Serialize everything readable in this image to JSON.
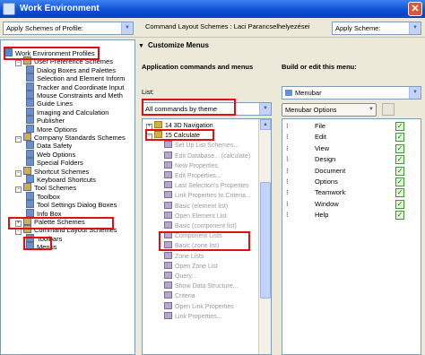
{
  "window": {
    "title": "Work Environment",
    "close_glyph": "✕"
  },
  "toolbar": {
    "apply_profile": "Apply Schemes of Profile:",
    "scheme_label": "Command Layout Schemes : Laci Parancselhelyezései",
    "apply_scheme": "Apply Scheme:"
  },
  "tree": [
    {
      "label": "Work Environment Profiles",
      "indent": 0,
      "expander": "",
      "icon_color": "#4a8cd8"
    },
    {
      "label": "User Preference Schemes",
      "indent": 1,
      "expander": "−",
      "icon_color": "#d4b040"
    },
    {
      "label": "Dialog Boxes and Palettes",
      "indent": 2,
      "expander": "",
      "icon_color": "#6a8fd0"
    },
    {
      "label": "Selection and Element Inform",
      "indent": 2,
      "expander": "",
      "icon_color": "#6a8fd0"
    },
    {
      "label": "Tracker and Coordinate Input",
      "indent": 2,
      "expander": "",
      "icon_color": "#6a8fd0"
    },
    {
      "label": "Mouse Constraints and Meth",
      "indent": 2,
      "expander": "",
      "icon_color": "#6a8fd0"
    },
    {
      "label": "Guide Lines",
      "indent": 2,
      "expander": "",
      "icon_color": "#6a8fd0"
    },
    {
      "label": "Imaging and Calculation",
      "indent": 2,
      "expander": "",
      "icon_color": "#6a8fd0"
    },
    {
      "label": "Publisher",
      "indent": 2,
      "expander": "",
      "icon_color": "#6a8fd0"
    },
    {
      "label": "More Options",
      "indent": 2,
      "expander": "",
      "icon_color": "#6a8fd0"
    },
    {
      "label": "Company Standards Schemes",
      "indent": 1,
      "expander": "−",
      "icon_color": "#d4b040"
    },
    {
      "label": "Data Safety",
      "indent": 2,
      "expander": "",
      "icon_color": "#6a8fd0"
    },
    {
      "label": "Web Options",
      "indent": 2,
      "expander": "",
      "icon_color": "#6a8fd0"
    },
    {
      "label": "Special Folders",
      "indent": 2,
      "expander": "",
      "icon_color": "#6a8fd0"
    },
    {
      "label": "Shortcut Schemes",
      "indent": 1,
      "expander": "−",
      "icon_color": "#d4b040"
    },
    {
      "label": "Keyboard Shortcuts",
      "indent": 2,
      "expander": "",
      "icon_color": "#6a8fd0"
    },
    {
      "label": "Tool Schemes",
      "indent": 1,
      "expander": "−",
      "icon_color": "#d4b040"
    },
    {
      "label": "Toolbox",
      "indent": 2,
      "expander": "",
      "icon_color": "#6a8fd0"
    },
    {
      "label": "Tool Settings Dialog Boxes",
      "indent": 2,
      "expander": "",
      "icon_color": "#6a8fd0"
    },
    {
      "label": "Info Box",
      "indent": 2,
      "expander": "",
      "icon_color": "#6a8fd0"
    },
    {
      "label": "Palette Schemes",
      "indent": 1,
      "expander": "+",
      "icon_color": "#d4b040"
    },
    {
      "label": "Command Layout Schemes",
      "indent": 1,
      "expander": "−",
      "icon_color": "#d4b040"
    },
    {
      "label": "Toolbars",
      "indent": 2,
      "expander": "",
      "icon_color": "#6a8fd0"
    },
    {
      "label": "Menus",
      "indent": 2,
      "expander": "",
      "icon_color": "#6a8fd0"
    }
  ],
  "customize": {
    "header": "Customize Menus",
    "header_glyph": "▼",
    "left_title": "Application commands and menus",
    "list_label": "List:",
    "list_value": "All commands by theme",
    "right_title": "Build or edit this menu:",
    "menu_value": "Menubar",
    "menubar_options": "Menubar Options",
    "combo_arrow": "▼",
    "scroll_up": "▲",
    "scroll_down": "▼"
  },
  "commands": [
    {
      "label": "14 3D Navigation",
      "expander": "+",
      "grey": false
    },
    {
      "label": "15 Calculate",
      "expander": "−",
      "grey": false
    },
    {
      "label": "Set Up List Schemes...",
      "expander": "",
      "grey": true
    },
    {
      "label": "Edit Database... (calculate)",
      "expander": "",
      "grey": true
    },
    {
      "label": "New Properties",
      "expander": "",
      "grey": true
    },
    {
      "label": "Edit Properties...",
      "expander": "",
      "grey": true
    },
    {
      "label": "Last Selection's Properties",
      "expander": "",
      "grey": true
    },
    {
      "label": "Link Properties to Criteria...",
      "expander": "",
      "grey": true
    },
    {
      "label": "Basic (element list)",
      "expander": "",
      "grey": true
    },
    {
      "label": "Open Element List",
      "expander": "",
      "grey": true
    },
    {
      "label": "Basic (component list)",
      "expander": "",
      "grey": true
    },
    {
      "label": "Component Lists",
      "expander": "",
      "grey": true
    },
    {
      "label": "Basic (zone list)",
      "expander": "",
      "grey": true
    },
    {
      "label": "Zone Lists",
      "expander": "",
      "grey": true
    },
    {
      "label": "Open Zone List",
      "expander": "",
      "grey": true
    },
    {
      "label": "Query...",
      "expander": "",
      "grey": true
    },
    {
      "label": "Show Data Structure...",
      "expander": "",
      "grey": true
    },
    {
      "label": "Criteria",
      "expander": "",
      "grey": true
    },
    {
      "label": "Open Link Properties",
      "expander": "",
      "grey": true
    },
    {
      "label": "Link Properties...",
      "expander": "",
      "grey": true
    }
  ],
  "menus": [
    {
      "label": "File",
      "dots": "⁝"
    },
    {
      "label": "Edit",
      "dots": "⁝"
    },
    {
      "label": "View",
      "dots": "⁝"
    },
    {
      "label": "Design",
      "dots": "⁝"
    },
    {
      "label": "Document",
      "dots": "⁝"
    },
    {
      "label": "Options",
      "dots": "⁝"
    },
    {
      "label": "Teamwork",
      "dots": "⁝"
    },
    {
      "label": "Window",
      "dots": "⁝"
    },
    {
      "label": "Help",
      "dots": "⁝"
    }
  ],
  "check_glyph": "✓",
  "colors": {
    "highlight": "#E01010",
    "titlebar": "#0A4DD4"
  }
}
